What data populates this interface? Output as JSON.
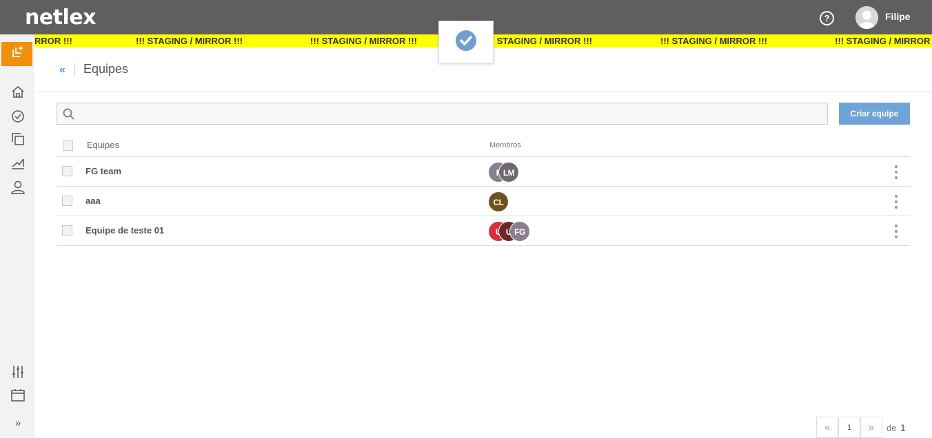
{
  "app": {
    "logo_text": "netlex",
    "brand_color": "#5f5f5f",
    "accent_color": "#f0900c",
    "primary_color": "#6fa4d8"
  },
  "header": {
    "help_label": "?",
    "user_name": "Filipe"
  },
  "banner": {
    "text_partial": "RROR !!!",
    "text": "!!! STAGING / MIRROR !!!",
    "color": "#ffff00"
  },
  "sidebar": {
    "new_icon": "new-item-icon",
    "items": [
      "home-icon",
      "tasks-check-icon",
      "documents-icon",
      "reports-chart-icon",
      "user-icon"
    ],
    "bottom_items": [
      "settings-sliders-icon",
      "calendar-icon",
      "expand-chevrons-icon"
    ]
  },
  "toast": {
    "icon": "success-check-icon"
  },
  "page": {
    "title": "Equipes"
  },
  "search": {
    "placeholder": "",
    "value": ""
  },
  "actions": {
    "create_label": "Criar equipe"
  },
  "table": {
    "headers": {
      "teams": "Equipes",
      "members": "Membros"
    },
    "rows": [
      {
        "name": "FG team",
        "members": [
          {
            "initials": "F",
            "color": "#8a7f8e"
          },
          {
            "initials": "LM",
            "color": "#6e6a6d"
          }
        ]
      },
      {
        "name": "aaa",
        "members": [
          {
            "initials": "CL",
            "color": "#6b5420"
          }
        ]
      },
      {
        "name": "Equipe de teste 01",
        "members": [
          {
            "initials": "U",
            "color": "#d9303f"
          },
          {
            "initials": "U",
            "color": "#6b2a2a"
          },
          {
            "initials": "FG",
            "color": "#8a7f8e"
          }
        ]
      }
    ]
  },
  "pagination": {
    "current_page": "1",
    "of_label": "de",
    "total_pages": "1"
  }
}
